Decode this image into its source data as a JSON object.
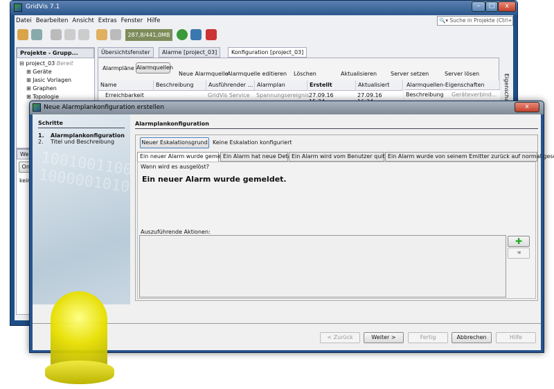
{
  "main_window": {
    "title": "GridVis 7.1",
    "menu": [
      "Datei",
      "Bearbeiten",
      "Ansicht",
      "Extras",
      "Fenster",
      "Hilfe"
    ],
    "search_placeholder": "Suche in Projekte (Ctrl+I)",
    "memory": "287,8/441,0MB",
    "projects_panel": {
      "title": "Projekte - Grupp...",
      "project": "project_03",
      "project_status": "Bereit",
      "items": [
        "Geräte",
        "Jasic Vorlagen",
        "Graphen",
        "Topologie"
      ]
    },
    "tabs": [
      "Übersichtsfenster",
      "Alarme [project_03]",
      "Konfiguration [project_03]"
    ],
    "toolbar": {
      "alarmplaene": "Alarmpläne",
      "alarmquellen": "Alarmquellen",
      "actions": [
        "Neue Alarmquelle",
        "Alarmquelle editieren",
        "Löschen",
        "Aktualisieren",
        "Server setzen",
        "Server lösen"
      ]
    },
    "table": {
      "columns": [
        "Name",
        "Beschreibung",
        "Ausführender ...",
        "Alarmplan",
        "Erstellt",
        "Aktualisiert"
      ],
      "rows": [
        [
          "Erreichbarkeit",
          "",
          "GridVis Service",
          "Spannungsereignis",
          "27.09.16 15:34:...",
          "27.09.16 16:24:..."
        ]
      ]
    },
    "properties": {
      "title": "Alarmquellen-Eigenschaften",
      "rows": [
        [
          "Beschreibung",
          "Geräteverbind..."
        ]
      ],
      "side_tab": "Eigenschaften"
    },
    "lower_panel": {
      "tab": "Wer",
      "button": "Onlin",
      "text": "kein"
    }
  },
  "dialog": {
    "title": "Neue Alarmplankonfiguration erstellen",
    "steps_title": "Schritte",
    "steps": [
      {
        "num": "1.",
        "label": "Alarmplankonfiguration"
      },
      {
        "num": "2.",
        "label": "Titel und Beschreibung"
      }
    ],
    "section_title": "Alarmplankonfiguration",
    "new_reason_button": "Neuer Eskalationsgrund",
    "escalation_status": "Keine Eskalation konfiguriert",
    "tabs": [
      "Ein neuer Alarm wurde gemeldet.",
      "Ein Alarm hat neue Details.",
      "Ein Alarm wird vom Benutzer quittiert.",
      "Ein Alarm wurde von seinem Emitter zurück auf normal gesetzt."
    ],
    "trigger_label": "Wann wird es ausgelöst?",
    "trigger_text": "Ein neuer Alarm wurde gemeldet.",
    "actions_label": "Auszuführende Aktionen:",
    "buttons": {
      "back": "< Zurück",
      "next": "Weiter >",
      "finish": "Fertig",
      "cancel": "Abbrechen",
      "help": "Hilfe"
    }
  }
}
